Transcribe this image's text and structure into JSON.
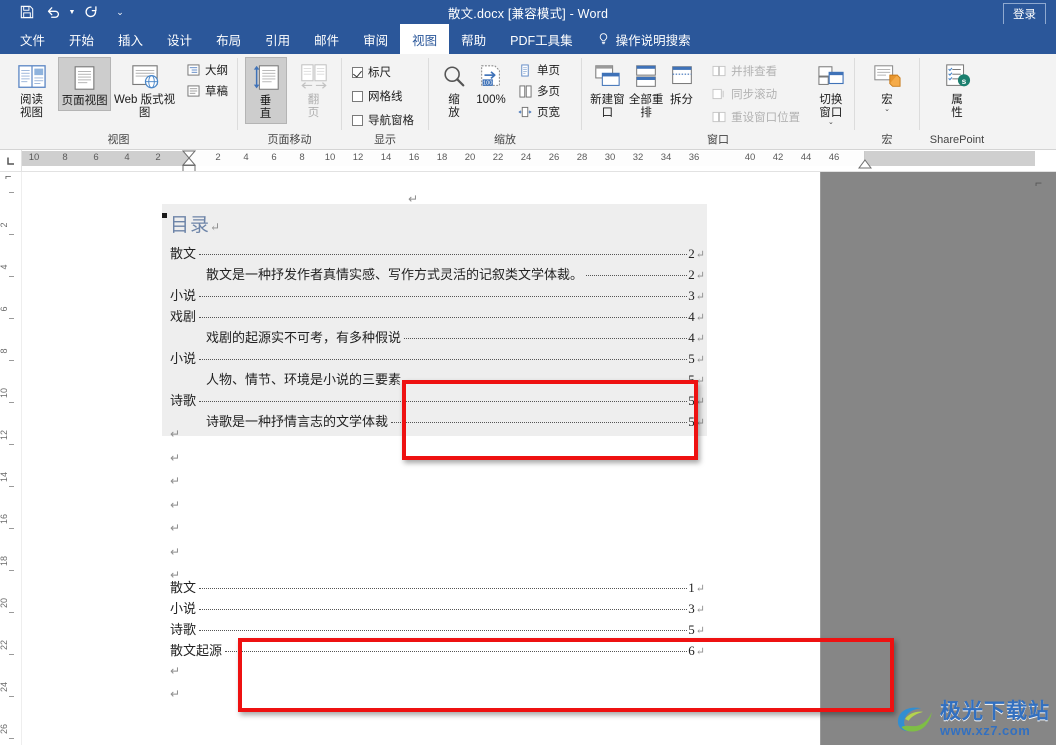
{
  "titlebar": {
    "document_title": "散文.docx [兼容模式]  -  Word",
    "signin_label": "登录",
    "quick_access": [
      {
        "name": "save-icon",
        "label": "保存"
      },
      {
        "name": "undo-icon",
        "label": "撤消"
      },
      {
        "name": "redo-icon",
        "label": "恢复"
      },
      {
        "name": "customize-qat-icon",
        "label": "自定义快速访问工具栏"
      }
    ]
  },
  "tabs": [
    {
      "label": "文件",
      "active": false
    },
    {
      "label": "开始",
      "active": false
    },
    {
      "label": "插入",
      "active": false
    },
    {
      "label": "设计",
      "active": false
    },
    {
      "label": "布局",
      "active": false
    },
    {
      "label": "引用",
      "active": false
    },
    {
      "label": "邮件",
      "active": false
    },
    {
      "label": "审阅",
      "active": false
    },
    {
      "label": "视图",
      "active": true
    },
    {
      "label": "帮助",
      "active": false
    },
    {
      "label": "PDF工具集",
      "active": false
    }
  ],
  "tell_me": {
    "label": "操作说明搜索",
    "icon": "lightbulb-icon"
  },
  "ribbon": {
    "groups": [
      {
        "label": "视图",
        "big_buttons": [
          {
            "label": "阅读视图",
            "selected": false,
            "disabled": false,
            "icon": "read-mode-icon"
          },
          {
            "label": "页面视图",
            "selected": true,
            "disabled": false,
            "icon": "print-layout-icon"
          },
          {
            "label": "Web 版式视图",
            "selected": false,
            "disabled": false,
            "icon": "web-layout-icon"
          }
        ],
        "small_items": [
          {
            "label": "大纲",
            "icon": "outline-icon",
            "disabled": false
          },
          {
            "label": "草稿",
            "icon": "draft-icon",
            "disabled": false
          }
        ]
      },
      {
        "label": "页面移动",
        "big_buttons": [
          {
            "label": "垂直",
            "selected": true,
            "disabled": false,
            "icon": "vertical-scroll-icon"
          },
          {
            "label": "翻页",
            "selected": false,
            "disabled": true,
            "icon": "side-to-side-icon"
          }
        ],
        "small_items": []
      },
      {
        "label": "显示",
        "big_buttons": [],
        "small_items": [
          {
            "label": "标尺",
            "checked": true,
            "disabled": false
          },
          {
            "label": "网格线",
            "checked": false,
            "disabled": false
          },
          {
            "label": "导航窗格",
            "checked": false,
            "disabled": false
          }
        ]
      },
      {
        "label": "缩放",
        "big_buttons": [
          {
            "label": "缩放",
            "selected": false,
            "disabled": false,
            "icon": "zoom-magnifier-icon"
          },
          {
            "label": "100%",
            "selected": false,
            "disabled": false,
            "icon": "zoom-100-icon"
          }
        ],
        "small_items": [
          {
            "label": "单页",
            "icon": "one-page-icon",
            "disabled": false
          },
          {
            "label": "多页",
            "icon": "multiple-pages-icon",
            "disabled": false
          },
          {
            "label": "页宽",
            "icon": "page-width-icon",
            "disabled": false
          }
        ]
      },
      {
        "label": "窗口",
        "big_buttons": [
          {
            "label": "新建窗口",
            "selected": false,
            "disabled": false,
            "icon": "new-window-icon"
          },
          {
            "label": "全部重排",
            "selected": false,
            "disabled": false,
            "icon": "arrange-all-icon"
          },
          {
            "label": "拆分",
            "selected": false,
            "disabled": false,
            "icon": "split-icon"
          }
        ],
        "small_items": [
          {
            "label": "并排查看",
            "icon": "view-side-by-side-icon",
            "disabled": true
          },
          {
            "label": "同步滚动",
            "icon": "synchronous-scrolling-icon",
            "disabled": true
          },
          {
            "label": "重设窗口位置",
            "icon": "reset-window-position-icon",
            "disabled": true
          }
        ],
        "extra_big": [
          {
            "label": "切换窗口",
            "icon": "switch-windows-icon",
            "has_caret": true
          }
        ]
      },
      {
        "label": "宏",
        "big_buttons": [
          {
            "label": "宏",
            "selected": false,
            "disabled": false,
            "icon": "macros-icon",
            "has_caret": true
          }
        ],
        "small_items": []
      },
      {
        "label": "SharePoint",
        "big_buttons": [
          {
            "label": "属性",
            "selected": false,
            "disabled": false,
            "icon": "properties-sharepoint-icon"
          }
        ],
        "small_items": []
      }
    ]
  },
  "ruler": {
    "horizontal_left_numbers": [
      "10",
      "8",
      "6",
      "4",
      "2"
    ],
    "horizontal_right_numbers": [
      "2",
      "4",
      "6",
      "8",
      "10",
      "12",
      "14",
      "16",
      "18",
      "20",
      "22",
      "24",
      "26",
      "28",
      "30",
      "32",
      "34",
      "36"
    ],
    "horizontal_far_numbers": [
      "40",
      "42",
      "44",
      "46"
    ],
    "vertical_numbers": [
      "2",
      "4",
      "6",
      "8",
      "10",
      "12",
      "14",
      "16",
      "18",
      "20",
      "22",
      "24",
      "26"
    ]
  },
  "document": {
    "toc_title": "目录",
    "pilcrow": "↵",
    "toc_entries": [
      {
        "text": "散文",
        "page": "2",
        "indent": false
      },
      {
        "text": "散文是一种抒发作者真情实感、写作方式灵活的记叙类文学体裁。",
        "page": "2",
        "indent": true
      },
      {
        "text": "小说",
        "page": "3",
        "indent": false
      },
      {
        "text": "戏剧",
        "page": "4",
        "indent": false
      },
      {
        "text": "戏剧的起源实不可考，有多种假说",
        "page": "4",
        "indent": true
      },
      {
        "text": "小说",
        "page": "5",
        "indent": false
      },
      {
        "text": "人物、情节、环境是小说的三要素",
        "page": "5",
        "indent": true
      },
      {
        "text": "诗歌",
        "page": "5",
        "indent": false
      },
      {
        "text": "诗歌是一种抒情言志的文学体裁",
        "page": "5",
        "indent": true
      }
    ],
    "toc_entries_lower": [
      {
        "text": "散文",
        "page": "1"
      },
      {
        "text": "小说",
        "page": "3"
      },
      {
        "text": "诗歌",
        "page": "5"
      },
      {
        "text": "散文起源",
        "page": "6"
      }
    ],
    "highlight_boxes": [
      {
        "name": "toc-upper-highlight",
        "color": "#ee1111"
      },
      {
        "name": "toc-lower-highlight",
        "color": "#ee1111"
      }
    ]
  },
  "watermark": {
    "brand_cn": "极光下载站",
    "url": "www.xz7.com"
  }
}
